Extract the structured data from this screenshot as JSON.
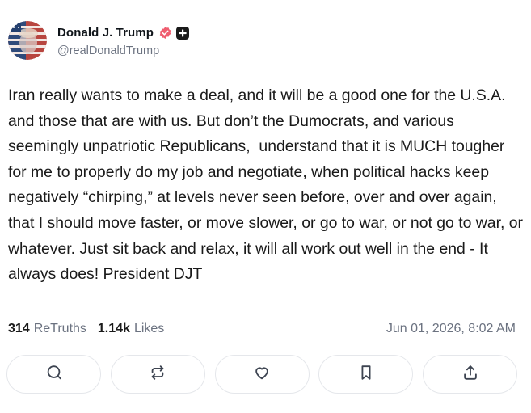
{
  "author": {
    "display_name": "Donald J. Trump",
    "handle": "@realDonaldTrump",
    "verified_icon": "verified-badge-icon",
    "plus_icon": "plus-badge-icon",
    "verified_color": "#ef5d6f"
  },
  "post": {
    "text": "Iran really wants to make a deal, and it will be a good one for the U.S.A. and those that are with us. But don’t the Dumocrats, and various seemingly unpatriotic Republicans,  understand that it is MUCH tougher for me to properly do my job and negotiate, when political hacks keep negatively “chirping,” at levels never seen before, over and over again, that I should move faster, or move slower, or go to war, or not go to war, or whatever. Just sit back and relax, it will all work out well in the end - It always does! President DJT"
  },
  "stats": {
    "retruths_count": "314",
    "retruths_label": "ReTruths",
    "likes_count": "1.14k",
    "likes_label": "Likes",
    "timestamp": "Jun 01, 2026, 8:02 AM"
  },
  "actions": [
    {
      "name": "reply",
      "icon": "comment-icon"
    },
    {
      "name": "retruth",
      "icon": "repost-icon"
    },
    {
      "name": "like",
      "icon": "heart-icon"
    },
    {
      "name": "bookmark",
      "icon": "bookmark-icon"
    },
    {
      "name": "share",
      "icon": "share-icon"
    }
  ]
}
